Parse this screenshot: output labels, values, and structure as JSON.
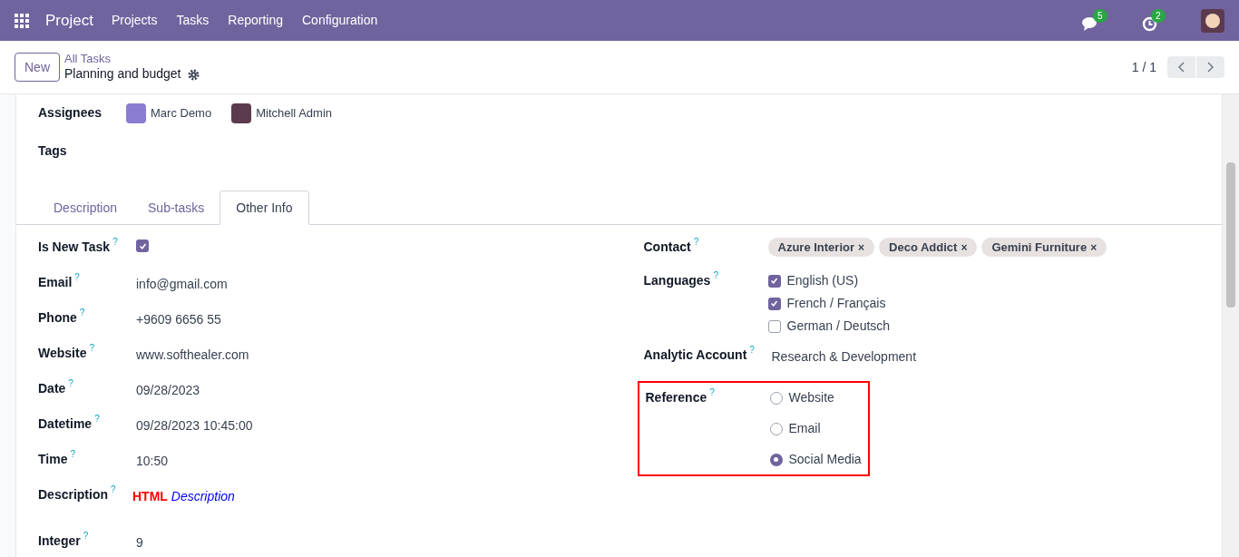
{
  "navbar": {
    "app": "Project",
    "menu": [
      "Projects",
      "Tasks",
      "Reporting",
      "Configuration"
    ],
    "messages_count": "5",
    "activities_count": "2"
  },
  "control_panel": {
    "new_button": "New",
    "breadcrumb": "All Tasks",
    "record_title": "Planning and budget",
    "pager": "1 / 1"
  },
  "top_fields": [
    {
      "label": "Assignees",
      "kind": "users",
      "users": [
        "Marc Demo",
        "Mitchell Admin"
      ]
    },
    {
      "label": "Tags",
      "kind": "empty"
    }
  ],
  "tabs": [
    {
      "label": "Description",
      "selected": false
    },
    {
      "label": "Sub-tasks",
      "selected": false
    },
    {
      "label": "Other Info",
      "selected": true
    }
  ],
  "left_fields": [
    {
      "label": "Is New Task",
      "help": "?",
      "kind": "checkbox",
      "checked": true
    },
    {
      "label": "Email",
      "help": "?",
      "kind": "text",
      "value": "info@gmail.com"
    },
    {
      "label": "Phone",
      "help": "?",
      "kind": "text",
      "value": "+9609 6656 55"
    },
    {
      "label": "Website",
      "help": "?",
      "kind": "text",
      "value": "www.softhealer.com"
    },
    {
      "label": "Date",
      "help": "?",
      "kind": "text",
      "value": "09/28/2023"
    },
    {
      "label": "Datetime",
      "help": "?",
      "kind": "text",
      "value": "09/28/2023 10:45:00"
    },
    {
      "label": "Time",
      "help": "?",
      "kind": "text",
      "value": "10:50"
    },
    {
      "label": "Description",
      "help": "?",
      "kind": "html",
      "value": "**HTML** *Description*"
    },
    {
      "label": "Integer",
      "help": "?",
      "kind": "text",
      "value": "9"
    }
  ],
  "right_fields": [
    {
      "label": "Contact",
      "help": "?",
      "kind": "tags",
      "tags": [
        "Azure Interior",
        "Deco Addict",
        "Gemini Furniture"
      ],
      "remove": "×"
    },
    {
      "label": "Languages",
      "help": "?",
      "kind": "checklist",
      "options": [
        {
          "label": "English (US)",
          "checked": true
        },
        {
          "label": "French / Français",
          "checked": true
        },
        {
          "label": "German / Deutsch",
          "checked": false
        }
      ]
    },
    {
      "label": "Analytic Account",
      "help": "?",
      "kind": "text",
      "value": "Research & Development"
    },
    {
      "label": "Reference",
      "help": "?",
      "kind": "radio",
      "highlighted": true,
      "options": [
        {
          "label": "Website",
          "selected": false
        },
        {
          "label": "Email",
          "selected": false
        },
        {
          "label": "Social Media",
          "selected": true
        }
      ]
    }
  ]
}
